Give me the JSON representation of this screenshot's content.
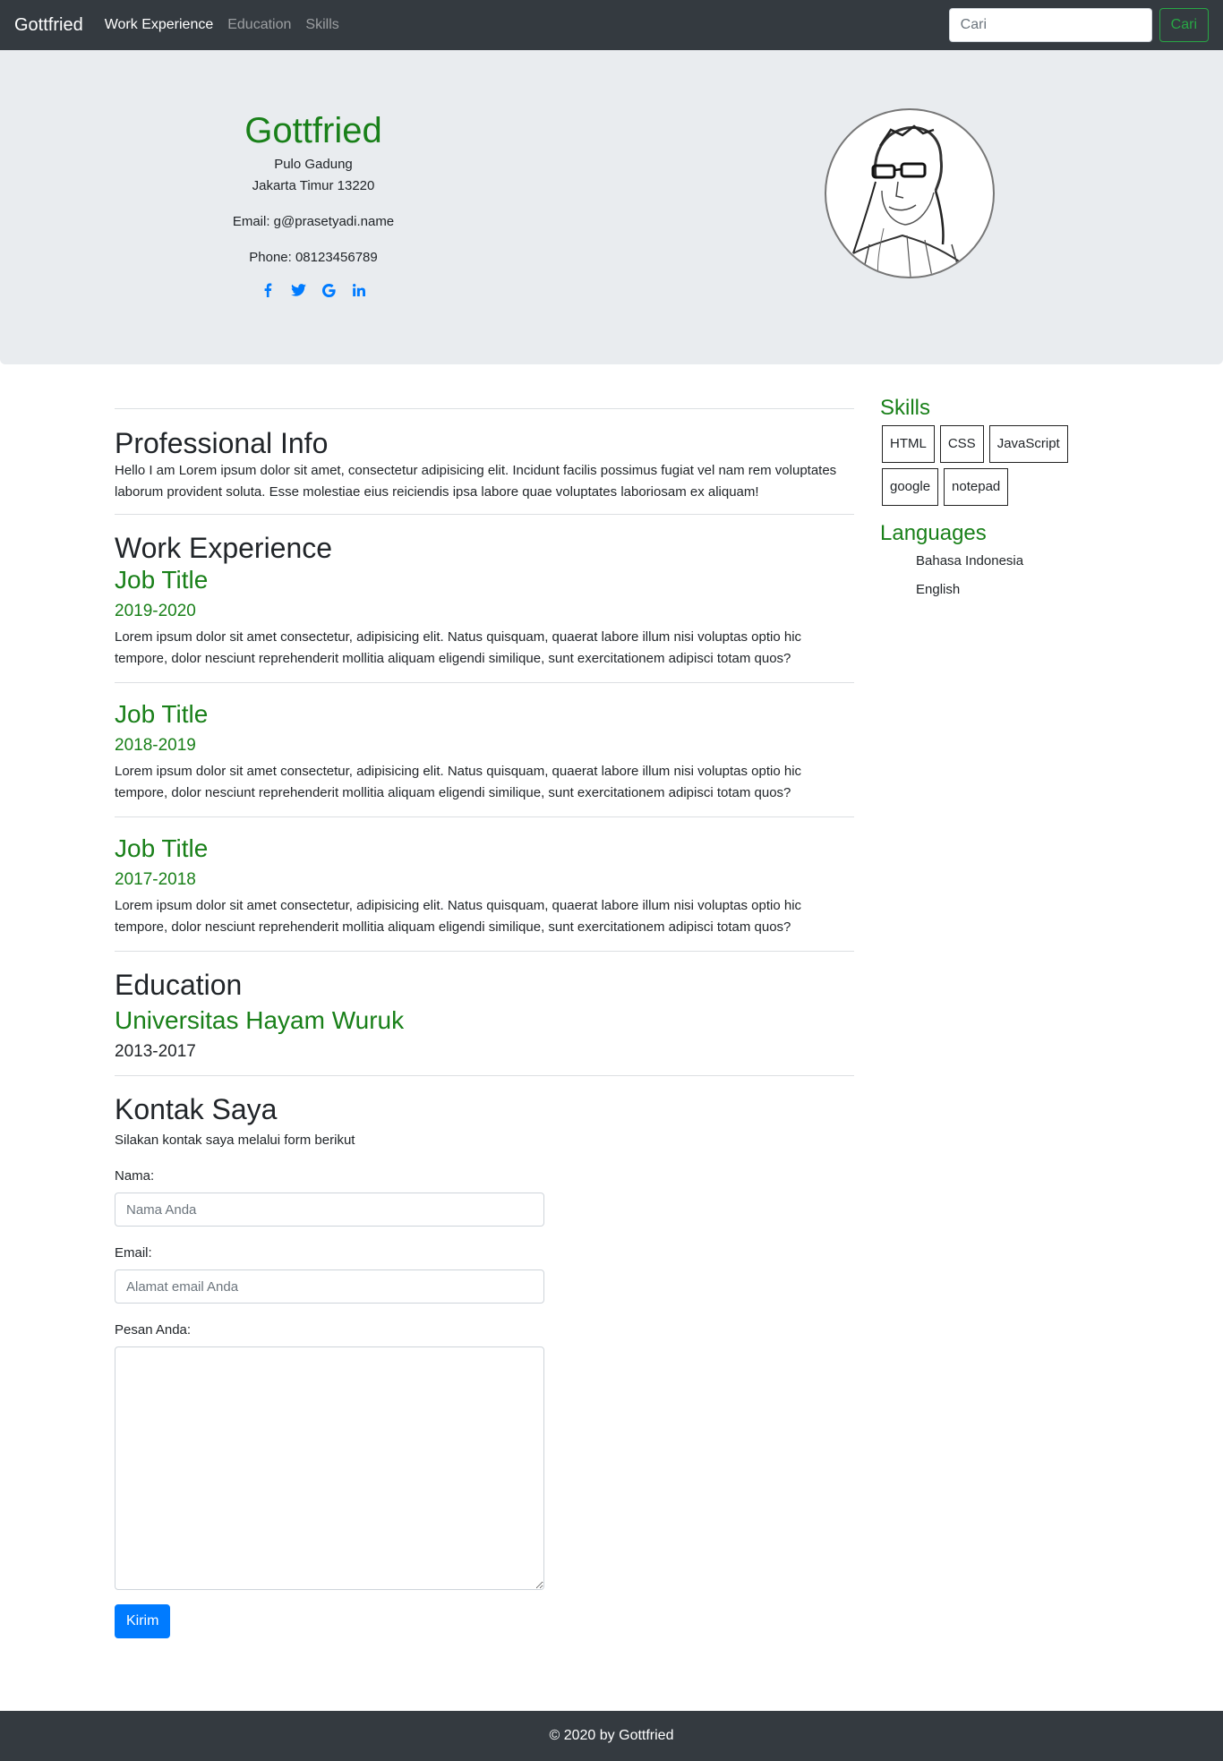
{
  "navbar": {
    "brand": "Gottfried",
    "links": [
      "Work Experience",
      "Education",
      "Skills"
    ],
    "search_placeholder": "Cari",
    "search_button": "Cari"
  },
  "profile": {
    "name": "Gottfried",
    "address_line1": "Pulo Gadung",
    "address_line2": "Jakarta Timur 13220",
    "email": "Email: g@prasetyadi.name",
    "phone": "Phone: 08123456789",
    "social_icons": [
      "facebook-icon",
      "twitter-icon",
      "google-icon",
      "linkedin-icon"
    ],
    "accent_color": "#198019",
    "social_color": "#007bff"
  },
  "professional": {
    "title": "Professional Info",
    "text": "Hello I am Lorem ipsum dolor sit amet, consectetur adipisicing elit. Incidunt facilis possimus fugiat vel nam rem voluptates laborum provident soluta. Esse molestiae eius reiciendis ipsa labore quae voluptates laboriosam ex aliquam!"
  },
  "work": {
    "title": "Work Experience",
    "jobs": [
      {
        "title": "Job Title",
        "years": "2019-2020",
        "text": "Lorem ipsum dolor sit amet consectetur, adipisicing elit. Natus quisquam, quaerat labore illum nisi voluptas optio hic tempore, dolor nesciunt reprehenderit mollitia aliquam eligendi similique, sunt exercitationem adipisci totam quos?"
      },
      {
        "title": "Job Title",
        "years": "2018-2019",
        "text": "Lorem ipsum dolor sit amet consectetur, adipisicing elit. Natus quisquam, quaerat labore illum nisi voluptas optio hic tempore, dolor nesciunt reprehenderit mollitia aliquam eligendi similique, sunt exercitationem adipisci totam quos?"
      },
      {
        "title": "Job Title",
        "years": "2017-2018",
        "text": "Lorem ipsum dolor sit amet consectetur, adipisicing elit. Natus quisquam, quaerat labore illum nisi voluptas optio hic tempore, dolor nesciunt reprehenderit mollitia aliquam eligendi similique, sunt exercitationem adipisci totam quos?"
      }
    ]
  },
  "education": {
    "title": "Education",
    "school": "Universitas Hayam Wuruk",
    "years": "2013-2017"
  },
  "contact": {
    "title": "Kontak Saya",
    "intro": "Silakan kontak saya melalui form berikut",
    "name_label": "Nama:",
    "name_placeholder": "Nama Anda",
    "email_label": "Email:",
    "email_placeholder": "Alamat email Anda",
    "message_label": "Pesan Anda:",
    "submit": "Kirim"
  },
  "sidebar": {
    "skills_title": "Skills",
    "skills": [
      "HTML",
      "CSS",
      "JavaScript",
      "google",
      "notepad"
    ],
    "languages_title": "Languages",
    "languages": [
      "Bahasa Indonesia",
      "English"
    ]
  },
  "footer": {
    "text": "© 2020 by Gottfried"
  }
}
